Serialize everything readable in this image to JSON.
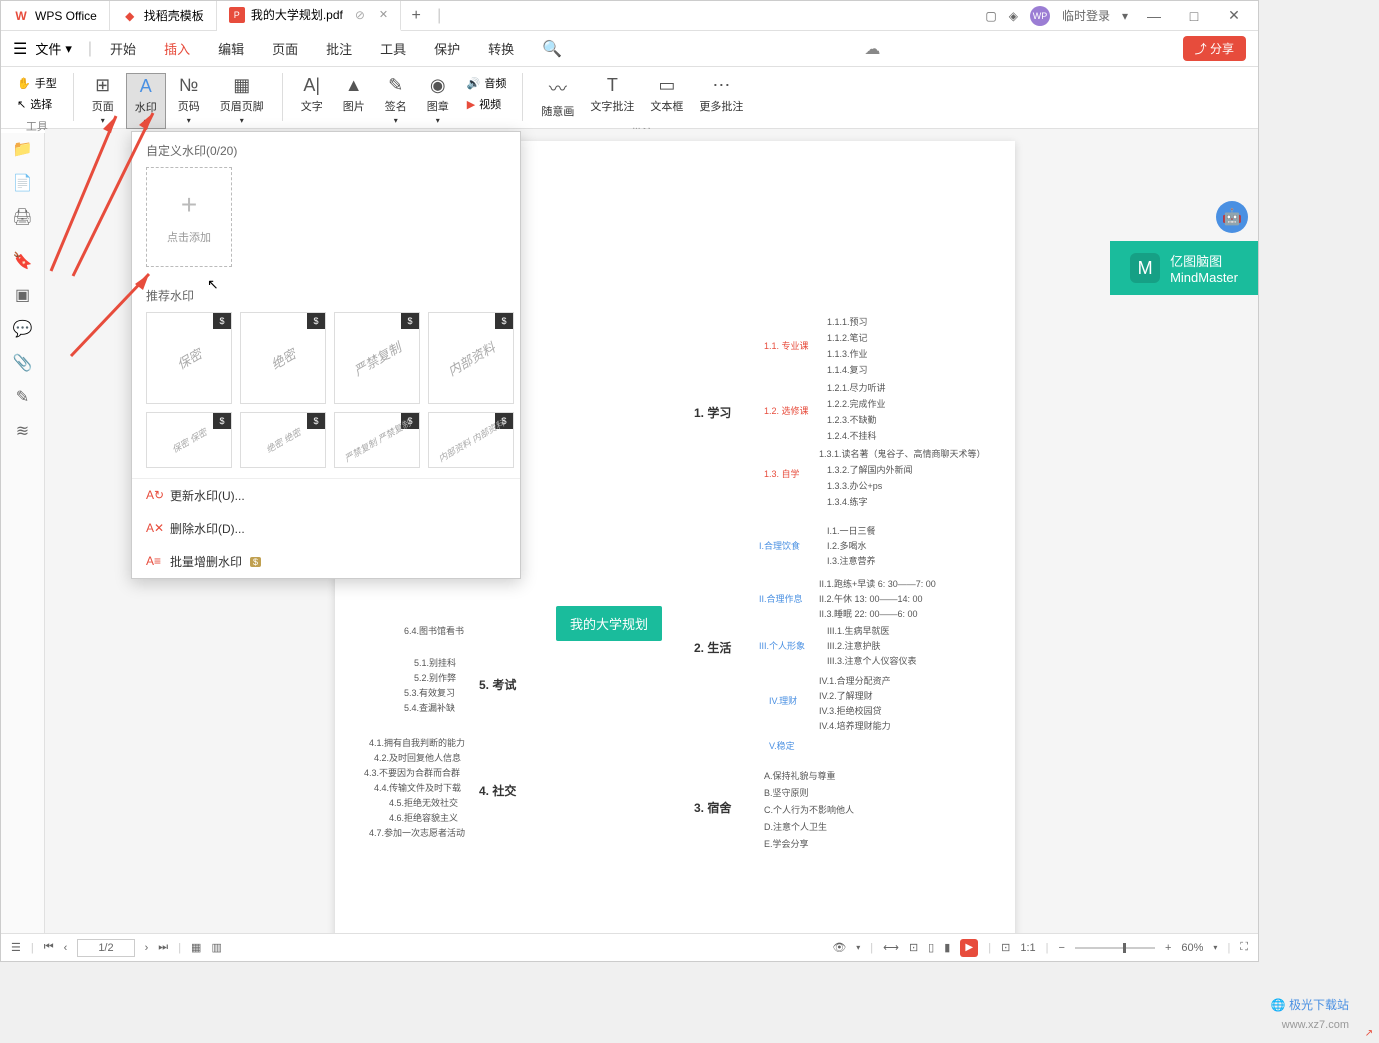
{
  "titlebar": {
    "app_name": "WPS Office",
    "tabs": [
      {
        "label": "找稻壳模板",
        "icon": "🔥"
      },
      {
        "label": "我的大学规划.pdf",
        "icon": "P",
        "active": true
      }
    ],
    "login_text": "临时登录",
    "window_controls": [
      "—",
      "□",
      "✕"
    ]
  },
  "menubar": {
    "file_label": "文件",
    "items": [
      "开始",
      "插入",
      "编辑",
      "页面",
      "批注",
      "工具",
      "保护",
      "转换"
    ],
    "active_index": 1,
    "share_label": "分享"
  },
  "ribbon": {
    "tool_group": {
      "hand": "手型",
      "select": "选择",
      "label": "工具"
    },
    "insert_buttons": [
      {
        "label": "页面",
        "icon": "⊞"
      },
      {
        "label": "水印",
        "icon": "A",
        "active": true
      },
      {
        "label": "页码",
        "icon": "№"
      },
      {
        "label": "页眉页脚",
        "icon": "▦"
      }
    ],
    "content_buttons": [
      {
        "label": "文字",
        "icon": "A|"
      },
      {
        "label": "图片",
        "icon": "▲"
      },
      {
        "label": "签名",
        "icon": "✎"
      },
      {
        "label": "图章",
        "icon": "◉"
      },
      {
        "label": "音频",
        "icon": "🔊"
      },
      {
        "label": "视频",
        "icon": "▶"
      }
    ],
    "annotate_buttons": [
      {
        "label": "随意画",
        "icon": "〰"
      },
      {
        "label": "文字批注",
        "icon": "T"
      },
      {
        "label": "文本框",
        "icon": "▭"
      },
      {
        "label": "更多批注",
        "icon": "⋯"
      }
    ],
    "annotate_label": "批注"
  },
  "watermark": {
    "custom_title": "自定义水印(0/20)",
    "add_label": "点击添加",
    "recommend_title": "推荐水印",
    "presets_row1": [
      "保密",
      "绝密",
      "严禁复制",
      "内部资料"
    ],
    "presets_row2": [
      "保密 保密",
      "绝密 绝密",
      "严禁复制 严禁复制",
      "内部资料 内部资料"
    ],
    "actions": {
      "update": "更新水印(U)...",
      "delete": "删除水印(D)...",
      "batch": "批量增删水印"
    }
  },
  "mindmap_brand": {
    "cn": "亿图脑图",
    "en": "MindMaster"
  },
  "mindmap": {
    "root": "我的大学规划",
    "mains": [
      "1. 学习",
      "2. 生活",
      "3. 宿舍",
      "4. 社交",
      "5. 考试"
    ],
    "study_branches": [
      "1.1. 专业课",
      "1.2. 选修课",
      "1.3. 自学"
    ],
    "study_11": [
      "1.1.1.预习",
      "1.1.2.笔记",
      "1.1.3.作业",
      "1.1.4.复习"
    ],
    "study_12": [
      "1.2.1.尽力听讲",
      "1.2.2.完成作业",
      "1.2.3.不缺勤",
      "1.2.4.不挂科"
    ],
    "study_13": [
      "1.3.1.读名著（鬼谷子、高情商聊天术等）",
      "1.3.2.了解国内外新闻",
      "1.3.3.办公+ps",
      "1.3.4.练字"
    ],
    "life_branches": [
      "I.合理饮食",
      "II.合理作息",
      "III.个人形象",
      "IV.理财",
      "V.稳定"
    ],
    "life_i": [
      "I.1.一日三餐",
      "I.2.多喝水",
      "I.3.注意营养"
    ],
    "life_ii": [
      "II.1.跑练+早读 6: 30——7: 00",
      "II.2.午休 13: 00——14: 00",
      "II.3.睡眠 22: 00——6: 00"
    ],
    "life_iii": [
      "III.1.生病早就医",
      "III.2.注意护肤",
      "III.3.注意个人仪容仪表"
    ],
    "life_iv": [
      "IV.1.合理分配资产",
      "IV.2.了解理财",
      "IV.3.拒绝校园贷",
      "IV.4.培养理财能力"
    ],
    "dorm": [
      "A.保持礼貌与尊重",
      "B.坚守原则",
      "C.个人行为不影响他人",
      "D.注意个人卫生",
      "E.学会分享"
    ],
    "social": [
      "4.1.拥有自我判断的能力",
      "4.2.及时回复他人信息",
      "4.3.不要因为合群而合群",
      "4.4.传输文件及时下载",
      "4.5.拒绝无效社交",
      "4.6.拒绝容貌主义",
      "4.7.参加一次志愿者活动"
    ],
    "exam": [
      "5.1.别挂科",
      "5.2.别作弊",
      "5.3.有效复习",
      "5.4.查漏补缺"
    ],
    "extra": "6.4.图书馆看书"
  },
  "statusbar": {
    "page": "1/2",
    "zoom": "60%"
  },
  "site": {
    "name": "极光下载站",
    "url": "www.xz7.com"
  }
}
